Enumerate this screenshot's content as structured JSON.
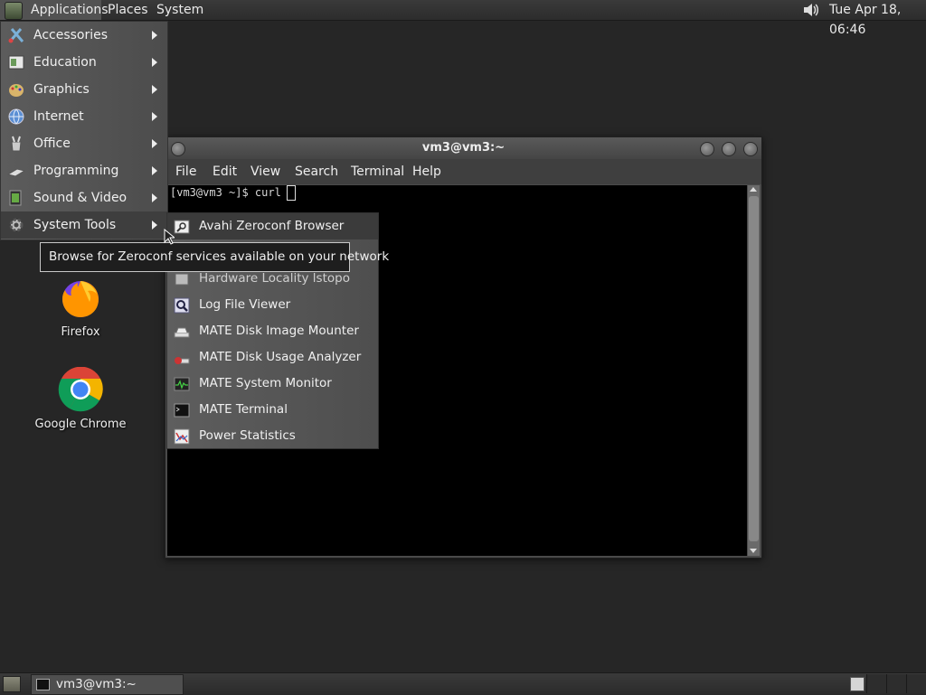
{
  "top_panel": {
    "applications_label": "Applications",
    "places_label": "Places",
    "system_label": "System",
    "clock": "Tue Apr 18, 06:46"
  },
  "desktop": {
    "icons": [
      {
        "label": "Firefox",
        "icon": "firefox-icon"
      },
      {
        "label": "Google Chrome",
        "icon": "chrome-icon"
      }
    ]
  },
  "terminal": {
    "title": "vm3@vm3:~",
    "menu": [
      "File",
      "Edit",
      "View",
      "Search",
      "Terminal",
      "Help"
    ],
    "prompt_line": "[vm3@vm3 ~]$ curl"
  },
  "apps_menu": {
    "items": [
      {
        "label": "Accessories",
        "icon": "accessories-icon"
      },
      {
        "label": "Education",
        "icon": "education-icon"
      },
      {
        "label": "Graphics",
        "icon": "graphics-icon"
      },
      {
        "label": "Internet",
        "icon": "internet-icon"
      },
      {
        "label": "Office",
        "icon": "office-icon"
      },
      {
        "label": "Programming",
        "icon": "programming-icon"
      },
      {
        "label": "Sound & Video",
        "icon": "sound-video-icon"
      },
      {
        "label": "System Tools",
        "icon": "system-tools-icon",
        "active": true
      }
    ]
  },
  "system_tools_menu": {
    "items": [
      {
        "label": "Avahi Zeroconf Browser",
        "icon": "avahi-icon",
        "highlighted": true
      },
      {
        "label": "Hardware Locality lstopo",
        "icon": "hardware-icon"
      },
      {
        "label": "Log File Viewer",
        "icon": "log-viewer-icon"
      },
      {
        "label": "MATE Disk Image Mounter",
        "icon": "disk-mounter-icon"
      },
      {
        "label": "MATE Disk Usage Analyzer",
        "icon": "disk-usage-icon"
      },
      {
        "label": "MATE System Monitor",
        "icon": "system-monitor-icon"
      },
      {
        "label": "MATE Terminal",
        "icon": "terminal-icon"
      },
      {
        "label": "Power Statistics",
        "icon": "power-stats-icon"
      }
    ]
  },
  "tooltip": {
    "text": "Browse for Zeroconf services available on your network"
  },
  "bottom_panel": {
    "task_label": "vm3@vm3:~"
  },
  "colors": {
    "desktop_bg": "#262626",
    "panel_bg": "#2e2e2e",
    "menu_bg": "#555555",
    "terminal_bg": "#000000"
  }
}
